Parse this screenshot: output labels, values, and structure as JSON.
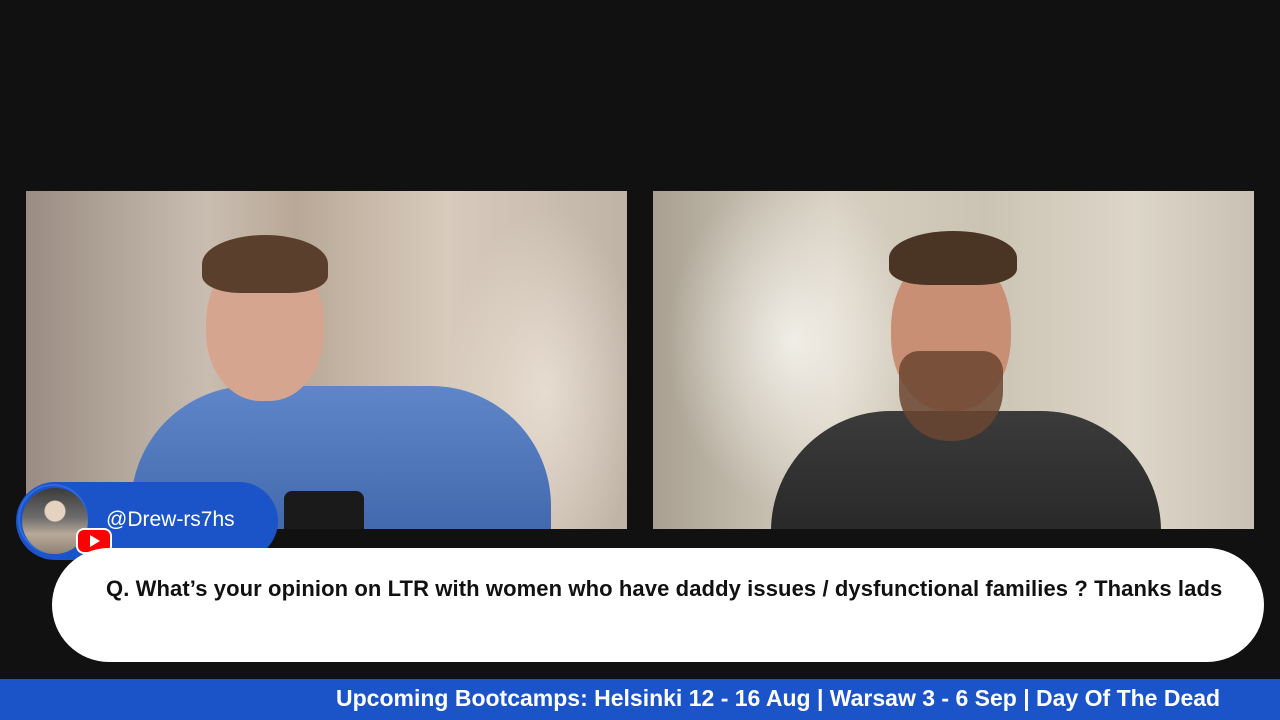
{
  "commenter": {
    "handle": "@Drew-rs7hs",
    "platform_icon": "youtube-icon"
  },
  "question": {
    "text": "Q. What’s your opinion on LTR with women who have daddy issues / dysfunctional families ? Thanks lads"
  },
  "ticker": {
    "text": "Upcoming Bootcamps: Helsinki 12 - 16 Aug | Warsaw 3 - 6 Sep | Day Of The Dead"
  },
  "colors": {
    "accent_blue": "#1a54c8",
    "background": "#111111",
    "youtube_red": "#ff0000"
  }
}
